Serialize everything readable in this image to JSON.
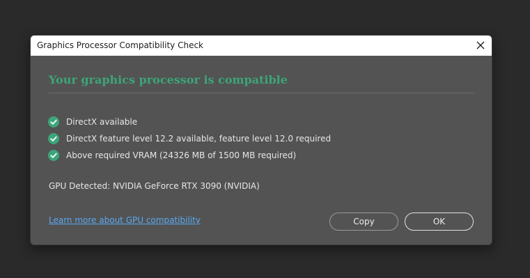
{
  "window": {
    "title": "Graphics Processor Compatibility Check"
  },
  "result": {
    "heading": "Your graphics processor is compatible"
  },
  "checks": [
    {
      "label": "DirectX available",
      "icon": "check-circle-icon",
      "status": "pass"
    },
    {
      "label": "DirectX feature level 12.2 available, feature level 12.0 required",
      "icon": "check-circle-icon",
      "status": "pass"
    },
    {
      "label": "Above required VRAM (24326 MB of 1500 MB required)",
      "icon": "check-circle-icon",
      "status": "pass"
    }
  ],
  "gpu": {
    "detected_text": "GPU Detected: NVIDIA GeForce RTX 3090 (NVIDIA)"
  },
  "footer": {
    "link_text": "Learn more about GPU compatibility",
    "copy_label": "Copy",
    "ok_label": "OK"
  },
  "colors": {
    "accent_green": "#3ca57a",
    "link_blue": "#5aa9f2",
    "dialog_bg": "#535353",
    "backdrop": "#2a2a2a"
  }
}
